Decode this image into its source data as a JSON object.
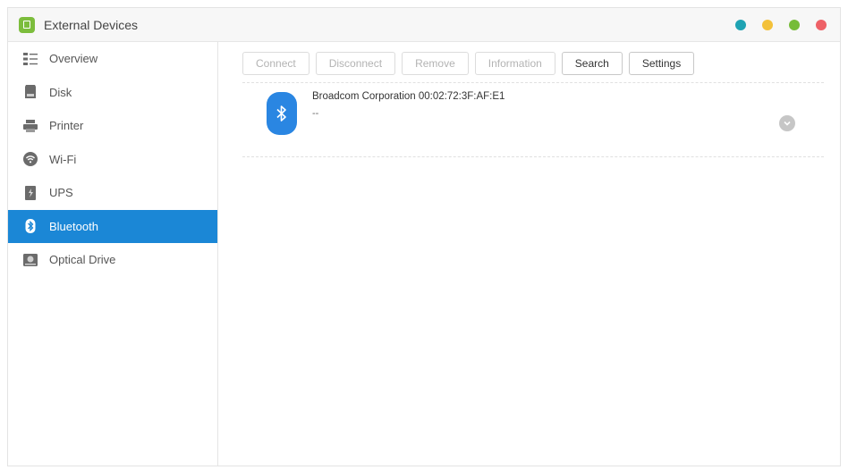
{
  "window": {
    "title": "External Devices"
  },
  "sidebar": {
    "items": [
      {
        "label": "Overview",
        "icon": "list-icon"
      },
      {
        "label": "Disk",
        "icon": "disk-icon"
      },
      {
        "label": "Printer",
        "icon": "printer-icon"
      },
      {
        "label": "Wi-Fi",
        "icon": "wifi-icon"
      },
      {
        "label": "UPS",
        "icon": "ups-icon"
      },
      {
        "label": "Bluetooth",
        "icon": "bluetooth-icon",
        "active": true
      },
      {
        "label": "Optical Drive",
        "icon": "optical-drive-icon"
      }
    ]
  },
  "toolbar": {
    "connect": "Connect",
    "disconnect": "Disconnect",
    "remove": "Remove",
    "information": "Information",
    "search": "Search",
    "settings": "Settings"
  },
  "device": {
    "name": "Broadcom Corporation 00:02:72:3F:AF:E1",
    "status": "--"
  },
  "colors": {
    "accent": "#1b87d6",
    "dot_teal": "#1fa3b3",
    "dot_yellow": "#f3c13a",
    "dot_green": "#76bc38",
    "dot_red": "#ee6167"
  }
}
